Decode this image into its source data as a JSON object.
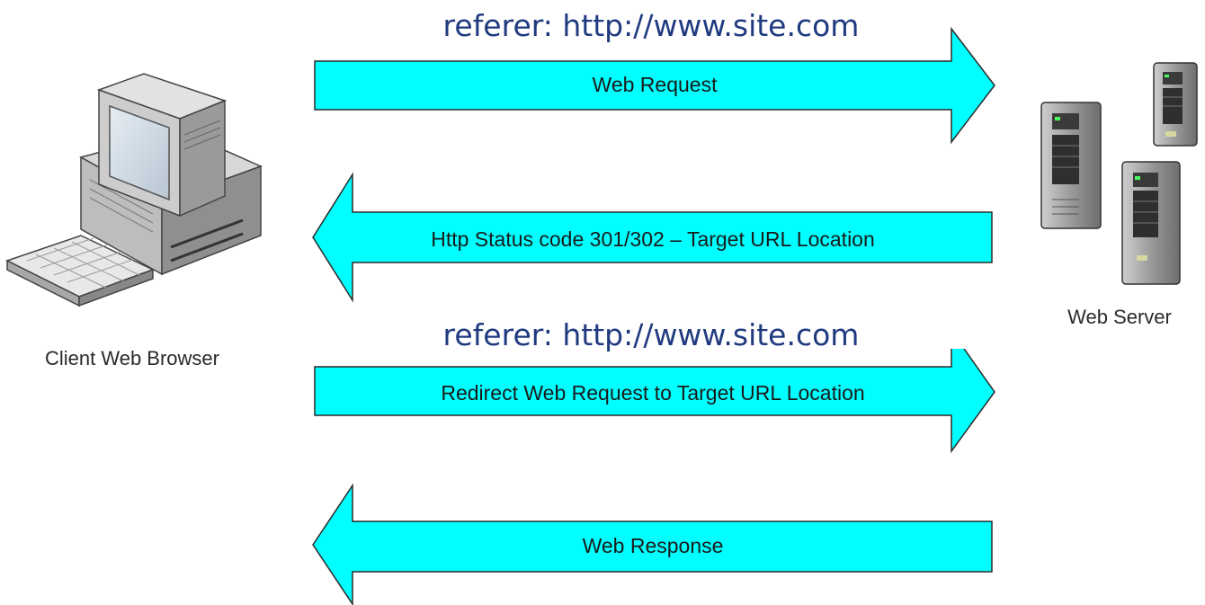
{
  "referer_top": "referer: http://www.site.com",
  "referer_middle": "referer: http://www.site.com",
  "arrows": {
    "web_request": "Web Request",
    "status_redirect": "Http Status code 301/302 – Target URL Location",
    "redirect_request": "Redirect Web Request to Target URL Location",
    "web_response": "Web Response"
  },
  "client": {
    "caption": "Client Web Browser",
    "icon": "desktop-computer-icon"
  },
  "server": {
    "caption": "Web Server",
    "icon": "server-tower-icon"
  },
  "colors": {
    "arrow_fill": "#00ffff",
    "referer_text": "#203a80"
  }
}
